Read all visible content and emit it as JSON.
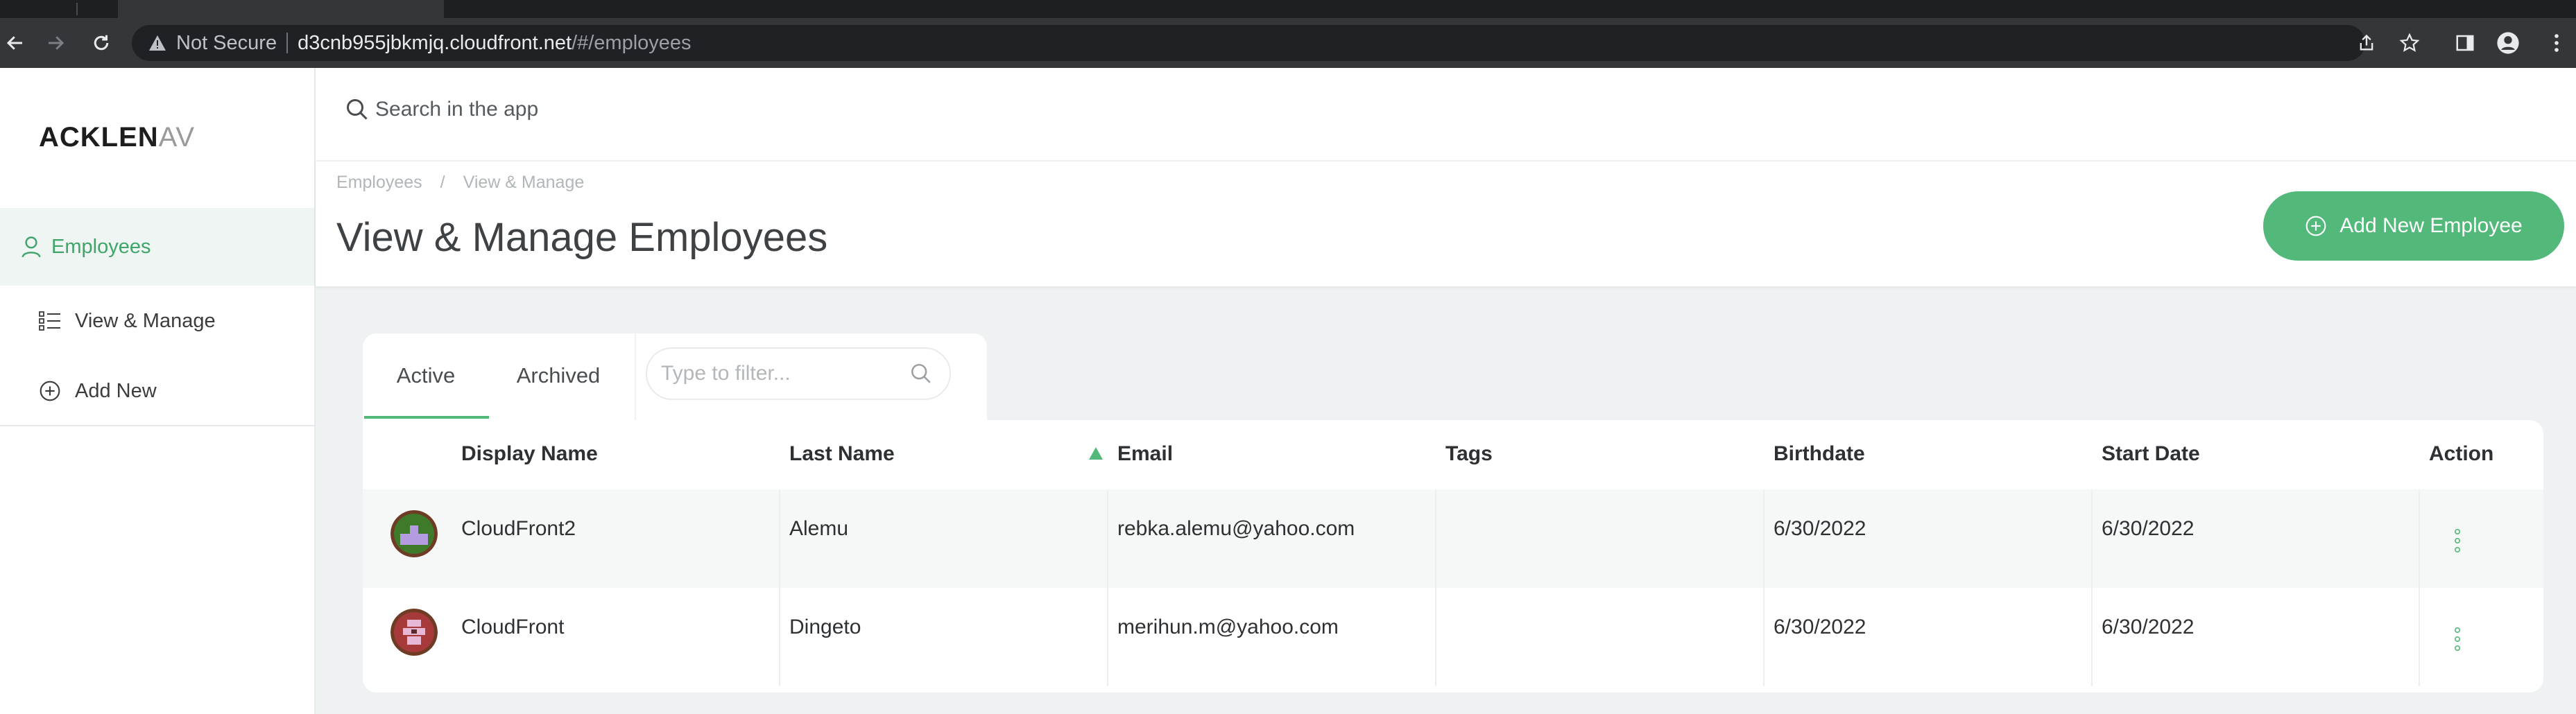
{
  "browser": {
    "security_label": "Not Secure",
    "url_host": "d3cnb955jbkmjq.cloudfront.net",
    "url_path": "/#/employees"
  },
  "sidebar": {
    "logo_main": "ACKLEN",
    "logo_fade": "AV",
    "section_label": "Employees",
    "items": [
      {
        "label": "View & Manage",
        "icon": "list-icon"
      },
      {
        "label": "Add New",
        "icon": "plus-circle-icon"
      }
    ]
  },
  "search": {
    "placeholder": "Search in the app"
  },
  "breadcrumb": {
    "items": [
      "Employees",
      "/",
      "View & Manage"
    ]
  },
  "page": {
    "title": "View & Manage Employees",
    "add_button_label": "Add New Employee"
  },
  "filters": {
    "tabs": [
      "Active",
      "Archived"
    ],
    "active_tab": "Active",
    "filter_placeholder": "Type to filter..."
  },
  "table": {
    "columns": [
      "Display Name",
      "Last Name",
      "Email",
      "Tags",
      "Birthdate",
      "Start Date",
      "Action"
    ],
    "sorted_column": "Email",
    "rows": [
      {
        "display_name": "CloudFront2",
        "last_name": "Alemu",
        "email": "rebka.alemu@yahoo.com",
        "tags": "",
        "birthdate": "6/30/2022",
        "start_date": "6/30/2022"
      },
      {
        "display_name": "CloudFront",
        "last_name": "Dingeto",
        "email": "merihun.m@yahoo.com",
        "tags": "",
        "birthdate": "6/30/2022",
        "start_date": "6/30/2022"
      }
    ]
  },
  "colors": {
    "accent": "#53b97b",
    "sidebar_active_bg": "#eef5f2",
    "page_bg": "#eff2f2"
  }
}
